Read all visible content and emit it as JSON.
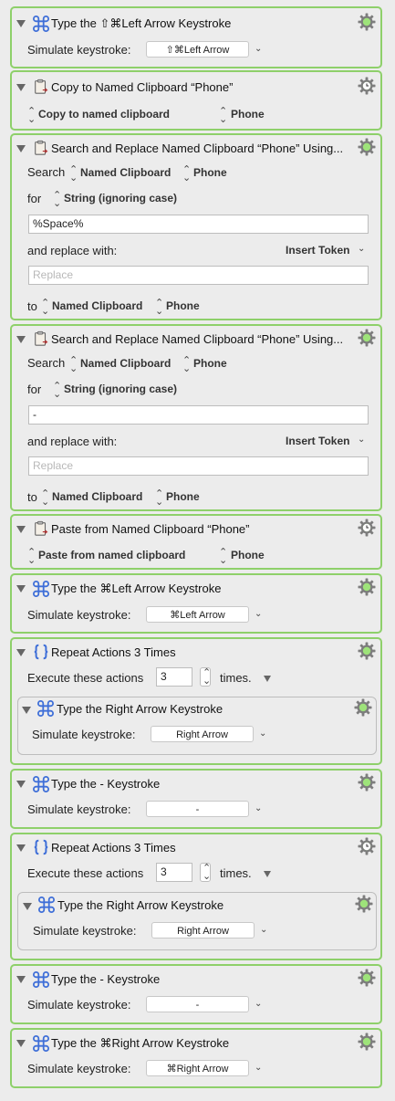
{
  "actions": [
    {
      "title": "Type the ⇧⌘Left Arrow Keystroke",
      "sim_label": "Simulate keystroke:",
      "key": "⇧⌘Left Arrow"
    },
    {
      "title": "Copy to Named Clipboard “Phone”",
      "mode": "Copy to named clipboard",
      "clip": "Phone"
    },
    {
      "title": "Search and Replace Named Clipboard “Phone” Using...",
      "search_label": "Search",
      "source": "Named Clipboard",
      "clip": "Phone",
      "for_label": "for",
      "match": "String (ignoring case)",
      "search_value": "%Space%",
      "replace_label": "and replace with:",
      "insert_token": "Insert Token",
      "replace_placeholder": "Replace",
      "to_label": "to",
      "dest": "Named Clipboard",
      "dest_clip": "Phone"
    },
    {
      "title": "Search and Replace Named Clipboard “Phone” Using...",
      "search_label": "Search",
      "source": "Named Clipboard",
      "clip": "Phone",
      "for_label": "for",
      "match": "String (ignoring case)",
      "search_value": "-",
      "replace_label": "and replace with:",
      "insert_token": "Insert Token",
      "replace_placeholder": "Replace",
      "to_label": "to",
      "dest": "Named Clipboard",
      "dest_clip": "Phone"
    },
    {
      "title": "Paste from Named Clipboard “Phone”",
      "mode": "Paste from named clipboard",
      "clip": "Phone"
    },
    {
      "title": "Type the ⌘Left Arrow Keystroke",
      "sim_label": "Simulate keystroke:",
      "key": "⌘Left Arrow"
    },
    {
      "title": "Repeat Actions 3 Times",
      "exec_label": "Execute these actions",
      "count": "3",
      "times_label": "times.",
      "child": {
        "title": "Type the Right Arrow Keystroke",
        "sim_label": "Simulate keystroke:",
        "key": "Right Arrow"
      }
    },
    {
      "title": "Type the - Keystroke",
      "sim_label": "Simulate keystroke:",
      "key": "-"
    },
    {
      "title": "Repeat Actions 3 Times",
      "exec_label": "Execute these actions",
      "count": "3",
      "times_label": "times.",
      "child": {
        "title": "Type the Right Arrow Keystroke",
        "sim_label": "Simulate keystroke:",
        "key": "Right Arrow"
      }
    },
    {
      "title": "Type the - Keystroke",
      "sim_label": "Simulate keystroke:",
      "key": "-"
    },
    {
      "title": "Type the ⌘Right Arrow Keystroke",
      "sim_label": "Simulate keystroke:",
      "key": "⌘Right Arrow"
    }
  ],
  "colors": {
    "accent_border": "#8ed06a",
    "icon_blue": "#3f6fd8",
    "gear_green": "#8ed06a"
  },
  "icons": {
    "keystroke": "command-icon",
    "clipboard": "clipboard-icon",
    "repeat": "braces-icon",
    "gear": "gear-icon",
    "disclosure": "disclosure-triangle-icon"
  }
}
